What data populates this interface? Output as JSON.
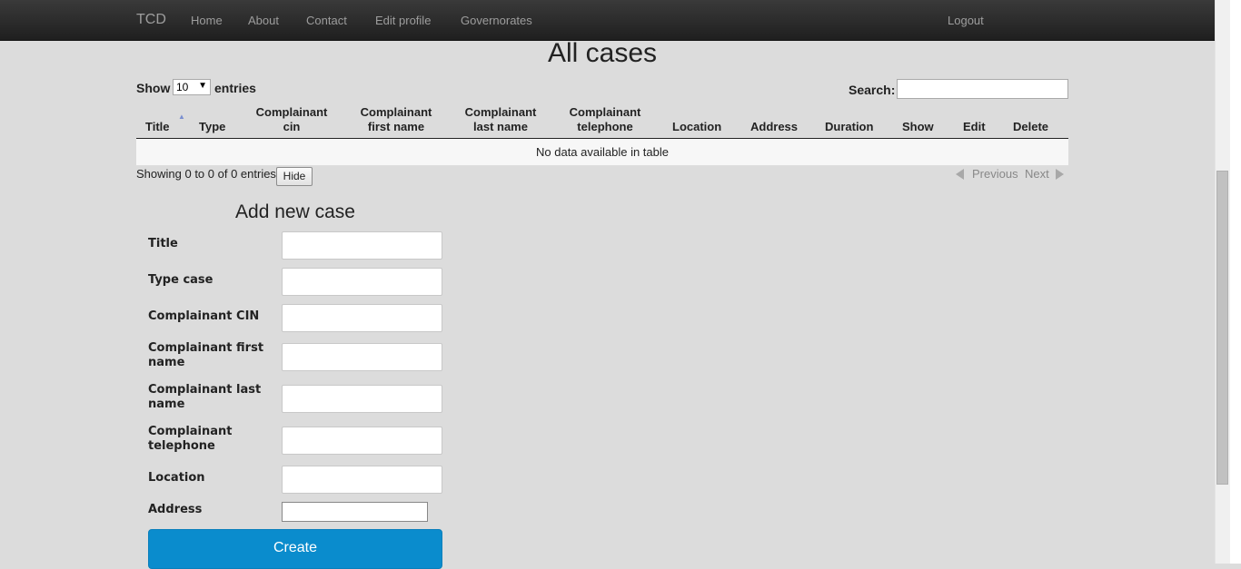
{
  "navbar": {
    "brand": "TCD",
    "links": [
      "Home",
      "About",
      "Contact",
      "Edit profile",
      "Governorates"
    ],
    "logout": "Logout"
  },
  "page_title": "All cases",
  "table_controls": {
    "show_label": "Show",
    "page_length": "10",
    "entries_label": "entries",
    "search_label": "Search:",
    "search_value": ""
  },
  "table": {
    "columns": [
      "Title",
      "Type",
      "Complainant cin",
      "Complainant first name",
      "Complainant last name",
      "Complainant telephone",
      "Location",
      "Address",
      "Duration",
      "Show",
      "Edit",
      "Delete"
    ],
    "column_lines": [
      [
        "Title"
      ],
      [
        "Type"
      ],
      [
        "Complainant",
        "cin"
      ],
      [
        "Complainant",
        "first name"
      ],
      [
        "Complainant",
        "last name"
      ],
      [
        "Complainant",
        "telephone"
      ],
      [
        "Location"
      ],
      [
        "Address"
      ],
      [
        "Duration"
      ],
      [
        "Show"
      ],
      [
        "Edit"
      ],
      [
        "Delete"
      ]
    ],
    "empty_message": "No data available in table",
    "info": "Showing 0 to 0 of 0 entries",
    "hide_label": "Hide",
    "previous_label": "Previous",
    "next_label": "Next"
  },
  "form": {
    "title": "Add new case",
    "fields": [
      {
        "label": "Title",
        "value": ""
      },
      {
        "label": "Type case",
        "value": ""
      },
      {
        "label": "Complainant CIN",
        "value": ""
      },
      {
        "label": "Complainant first name",
        "value": ""
      },
      {
        "label": "Complainant last name",
        "value": ""
      },
      {
        "label": "Complainant telephone",
        "value": ""
      },
      {
        "label": "Location",
        "value": ""
      },
      {
        "label": "Address",
        "value": ""
      }
    ],
    "submit_label": "Create"
  },
  "colors": {
    "navbar_bg": "#2b2b2b",
    "page_bg": "#dcdcdc",
    "primary_button": "#0a8ccd"
  }
}
